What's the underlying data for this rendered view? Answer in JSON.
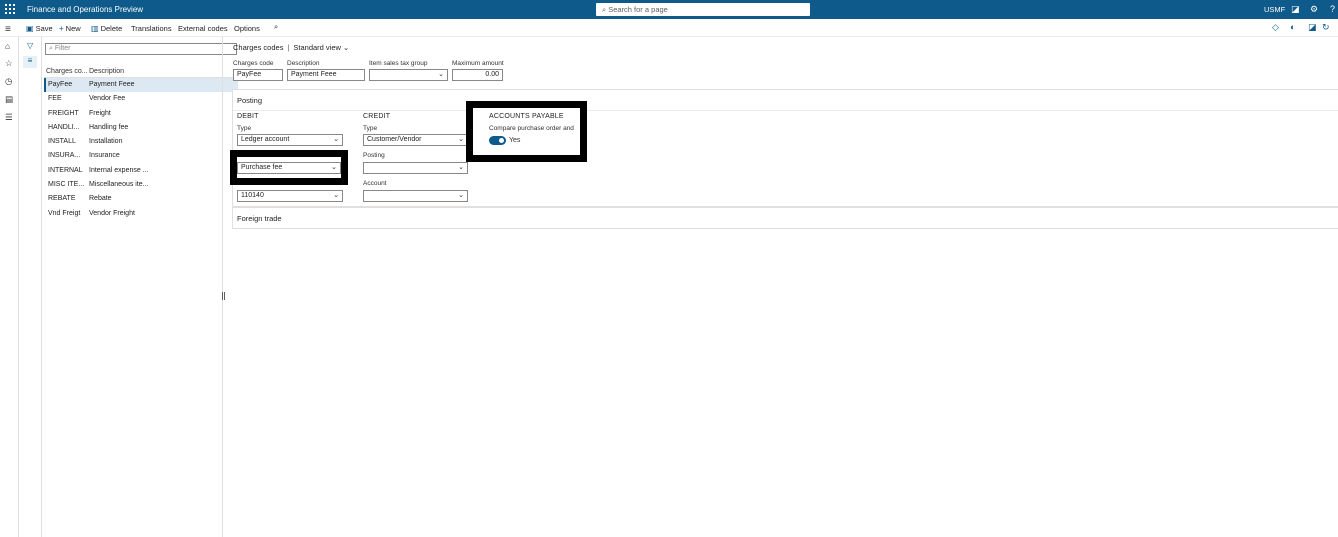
{
  "topbar": {
    "app_title": "Finance and Operations Preview",
    "search_placeholder": "Search for a page",
    "company": "USMF",
    "icons": [
      "waffle-icon",
      "search-icon",
      "chat-icon",
      "settings-icon",
      "help-icon"
    ]
  },
  "actions": {
    "save": "Save",
    "new": "New",
    "delete": "Delete",
    "translations": "Translations",
    "external_codes": "External codes",
    "options": "Options"
  },
  "list": {
    "filter_placeholder": "Filter",
    "columns": [
      "Charges co...",
      "Description"
    ],
    "rows": [
      {
        "code": "PayFee",
        "description": "Payment Feee"
      },
      {
        "code": "FEE",
        "description": "Vendor Fee"
      },
      {
        "code": "FREIGHT",
        "description": "Freight"
      },
      {
        "code": "HANDLI...",
        "description": "Handling fee"
      },
      {
        "code": "INSTALL",
        "description": "Installation"
      },
      {
        "code": "INSURA...",
        "description": "Insurance"
      },
      {
        "code": "INTERNAL",
        "description": "Internal expense ..."
      },
      {
        "code": "MISC ITE...",
        "description": "Miscellaneous ite..."
      },
      {
        "code": "REBATE",
        "description": "Rebate"
      },
      {
        "code": "Vnd Freigt",
        "description": "Vendor Freight"
      }
    ],
    "selected_index": 0
  },
  "detail": {
    "breadcrumb": "Charges codes",
    "view": "Standard view",
    "header_fields": {
      "charges_code_label": "Charges code",
      "charges_code_value": "PayFee",
      "description_label": "Description",
      "description_value": "Payment Feee",
      "item_tax_label": "Item sales tax group",
      "item_tax_value": "",
      "max_amount_label": "Maximum amount",
      "max_amount_value": "0.00"
    },
    "posting": {
      "title": "Posting",
      "debit": {
        "title": "DEBIT",
        "type_label": "Type",
        "type_value": "Ledger account",
        "posting_value": "Purchase fee",
        "account_value": "110140"
      },
      "credit": {
        "title": "CREDIT",
        "type_label": "Type",
        "type_value": "Customer/Vendor",
        "posting_label": "Posting",
        "posting_value": "",
        "account_label": "Account",
        "account_value": ""
      },
      "accounts_payable": {
        "title": "ACCOUNTS PAYABLE",
        "compare_label": "Compare purchase order and",
        "toggle_text": "Yes",
        "toggle_on": true
      }
    },
    "foreign_trade": {
      "title": "Foreign trade"
    }
  },
  "colors": {
    "brand": "#0e5a8a",
    "selected_row": "#dde9f2"
  }
}
